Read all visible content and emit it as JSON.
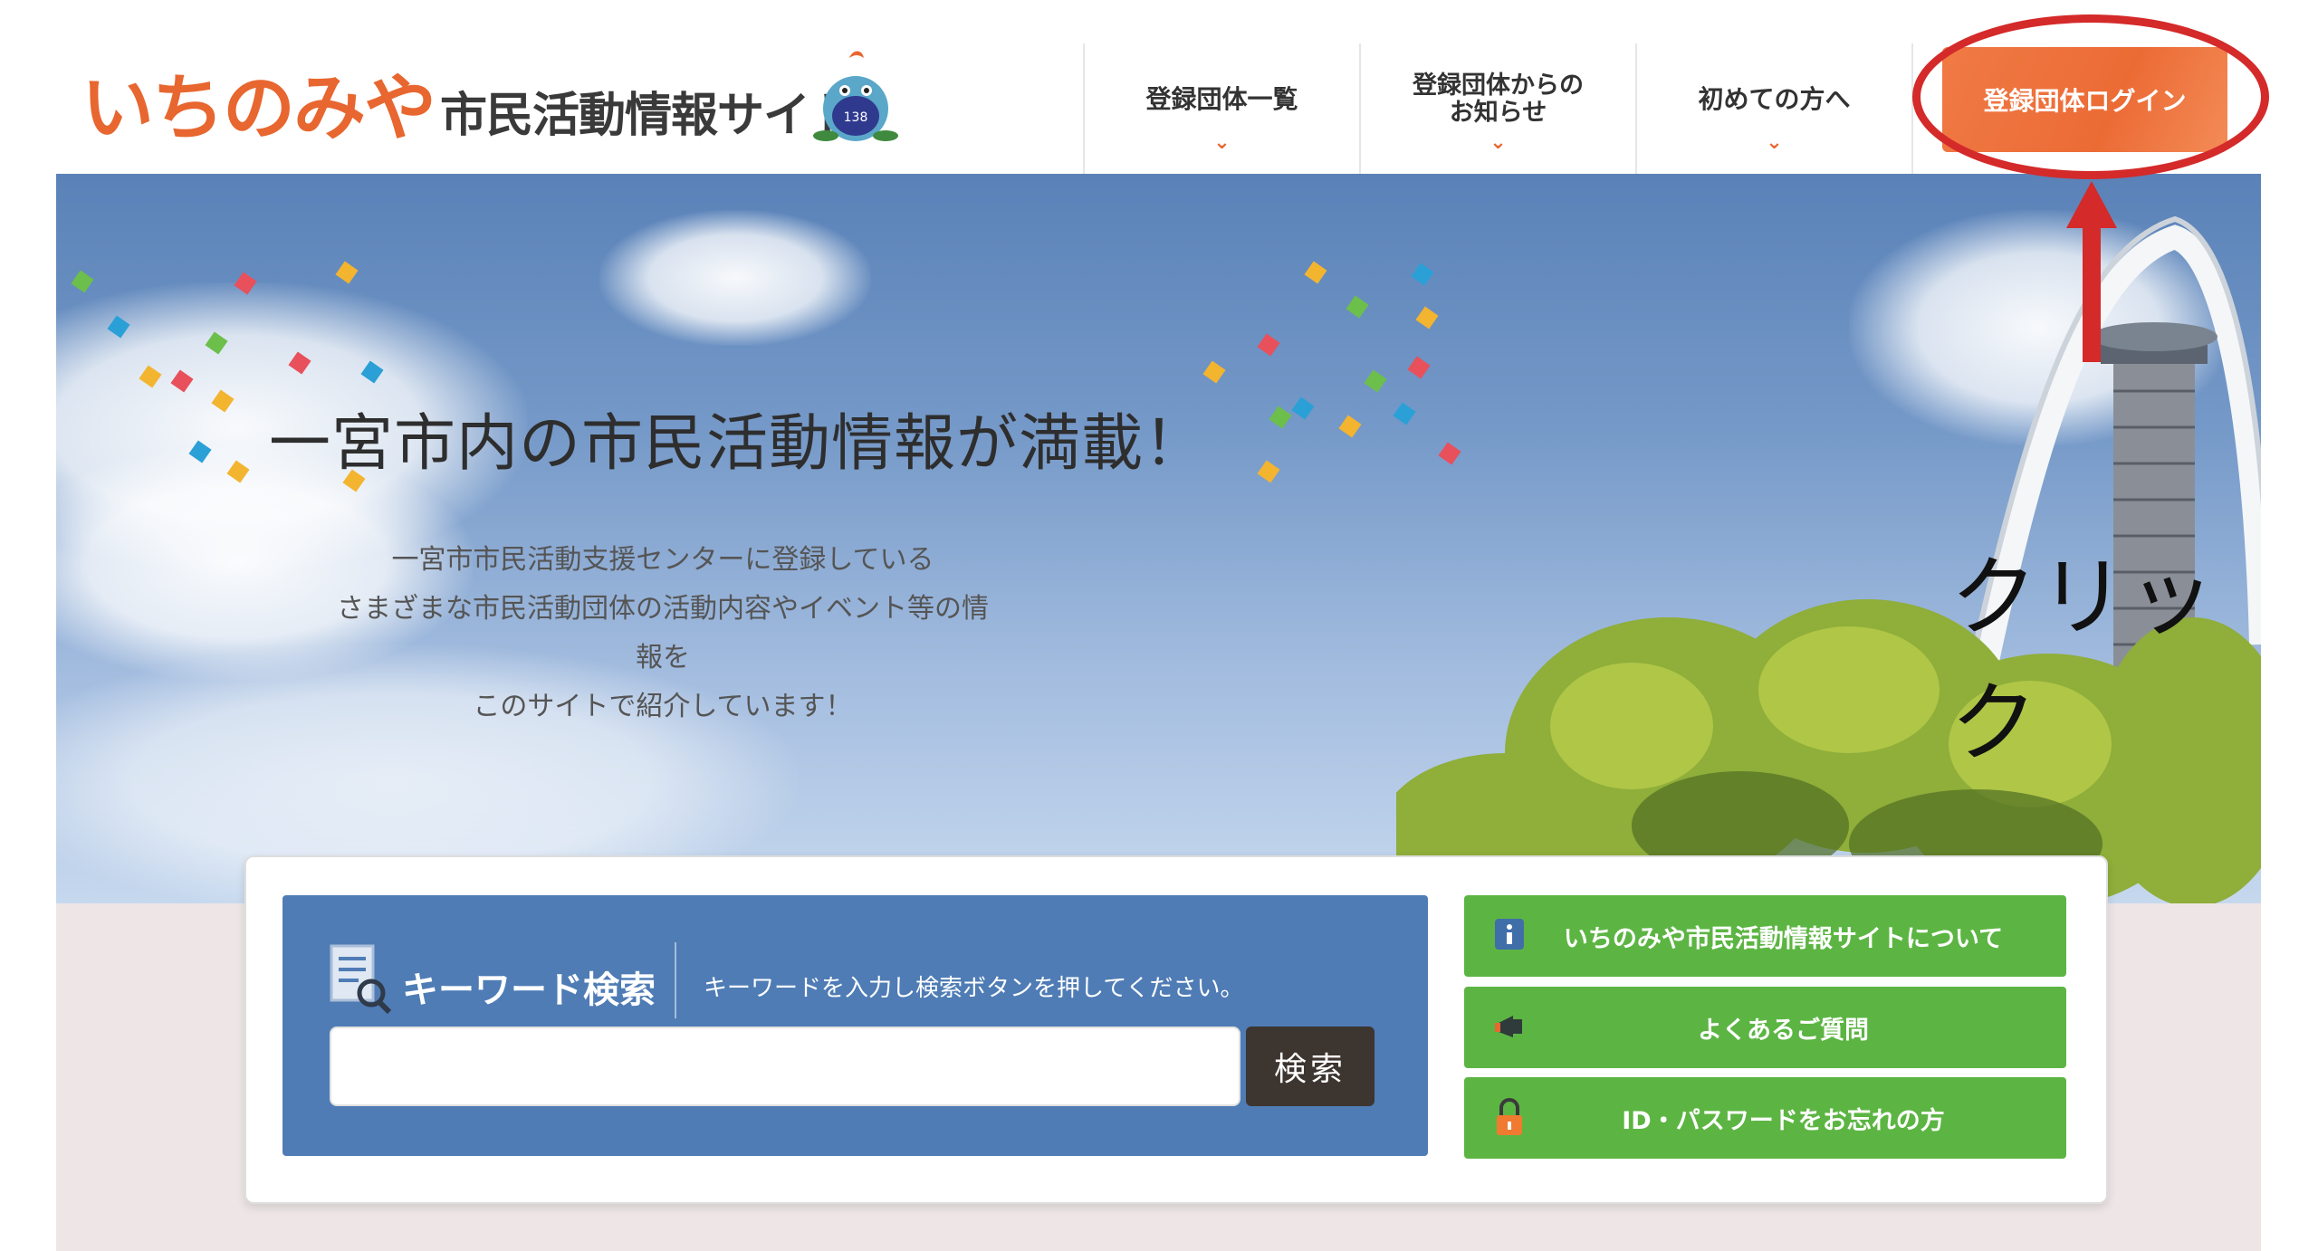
{
  "header": {
    "logo_main": "いちのみや",
    "logo_sub": "市民活動情報サイト",
    "mascot_badge": "138",
    "nav": [
      {
        "label": "登録団体一覧"
      },
      {
        "label": "登録団体からの\nお知らせ"
      },
      {
        "label": "初めての方へ"
      }
    ],
    "chevron": "⌄",
    "login_label": "登録団体ログイン"
  },
  "hero": {
    "title": "一宮市内の市民活動情報が満載！",
    "description": "一宮市市民活動支援センターに登録している\nさまざまな市民活動団体の活動内容やイベント等の情報を\nこのサイトで紹介しています！",
    "annotation": "クリック"
  },
  "search": {
    "title": "キーワード検索",
    "hint": "キーワードを入力し検索ボタンを押してください。",
    "input_value": "",
    "button_label": "検索"
  },
  "links": [
    {
      "label": "いちのみや市民活動情報サイトについて",
      "icon": "info-icon"
    },
    {
      "label": "よくあるご質問",
      "icon": "megaphone-icon"
    },
    {
      "label": "ID・パスワードをお忘れの方",
      "icon": "lock-icon"
    }
  ],
  "colors": {
    "brand_orange": "#e8662f",
    "annotation_red": "#d42a2a",
    "search_blue": "#4f7cb5",
    "link_green": "#5cb543",
    "search_button": "#3d3530"
  }
}
